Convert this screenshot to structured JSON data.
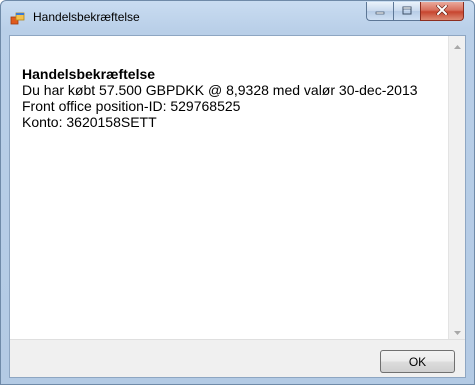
{
  "window": {
    "title": "Handelsbekræftelse",
    "icon": "app-window-icon"
  },
  "caption_buttons": {
    "minimize_icon": "minimize-icon",
    "maximize_icon": "maximize-icon",
    "close_icon": "close-icon"
  },
  "message": {
    "title": "Handelsbekræftelse",
    "line1": "Du har købt 57.500 GBPDKK @ 8,9328 med valør 30-dec-2013",
    "line2": "Front office position-ID: 529768525",
    "line3": "Konto: 3620158SETT"
  },
  "footer": {
    "ok_label": "OK"
  },
  "colors": {
    "titlebar": "#c9dcf1",
    "close_button": "#c7452f",
    "client_background": "#ffffff",
    "footer_background": "#f0f0f0"
  }
}
